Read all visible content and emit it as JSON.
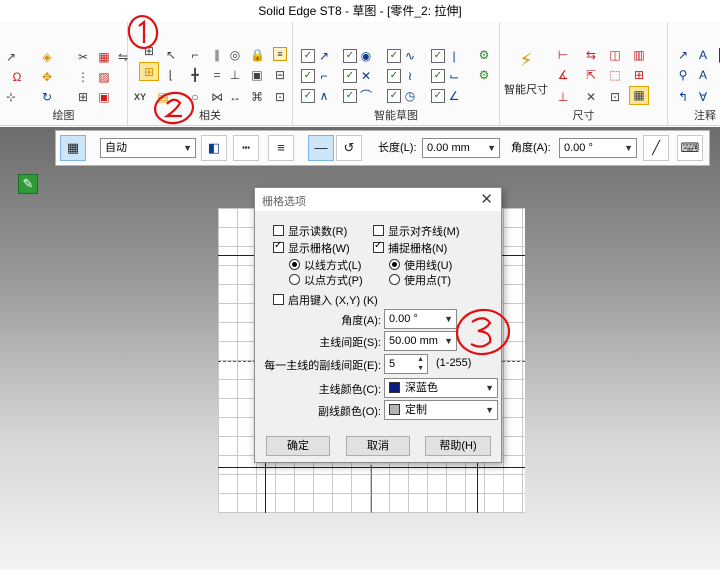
{
  "window": {
    "title": "Solid Edge ST8 - 草图 - [零件_2: 拉伸]"
  },
  "ribbon": {
    "groups": [
      {
        "label": "绘图"
      },
      {
        "label": "相关"
      },
      {
        "label": "智能草图"
      },
      {
        "label": "尺寸",
        "big_button": "智能尺寸"
      },
      {
        "label": "注释"
      }
    ]
  },
  "command_bar": {
    "style_select": "自动",
    "length_label": "长度(L):",
    "length_value": "0.00 mm",
    "angle_label": "角度(A):",
    "angle_value": "0.00 °"
  },
  "dialog": {
    "title": "栅格选项",
    "show_readout": {
      "label": "显示读数(R)",
      "checked": false
    },
    "show_align_lines": {
      "label": "显示对齐线(M)",
      "checked": false
    },
    "show_grid": {
      "label": "显示栅格(W)",
      "checked": true
    },
    "snap_grid": {
      "label": "捕捉栅格(N)",
      "checked": true
    },
    "radio_line_mode": {
      "label": "以线方式(L)",
      "checked": true
    },
    "radio_point_mode": {
      "label": "以点方式(P)",
      "checked": false
    },
    "radio_use_lines": {
      "label": "使用线(U)",
      "checked": true
    },
    "radio_use_points": {
      "label": "使用点(T)",
      "checked": false
    },
    "key_entry": {
      "label": "启用键入 (X,Y) (K)",
      "checked": false
    },
    "angle": {
      "label": "角度(A):",
      "value": "0.00 °"
    },
    "major_spacing": {
      "label": "主线间距(S):",
      "value": "50.00 mm"
    },
    "minor_count": {
      "label": "每一主线的副线间距(E):",
      "value": "5",
      "range": "(1-255)"
    },
    "major_color": {
      "label": "主线颜色(C):",
      "value": "深蓝色",
      "swatch": "#0a1a80"
    },
    "minor_color": {
      "label": "副线颜色(O):",
      "value": "定制",
      "swatch": "#b4b4b4"
    },
    "ok_label": "确定",
    "cancel_label": "取消",
    "help_label": "帮助(H)"
  },
  "colors": {
    "major_grid_line": "#0a1a80",
    "origin_line_red": "#d22222",
    "origin_line_green": "#2aa82a",
    "annotation_red": "#e01010"
  }
}
